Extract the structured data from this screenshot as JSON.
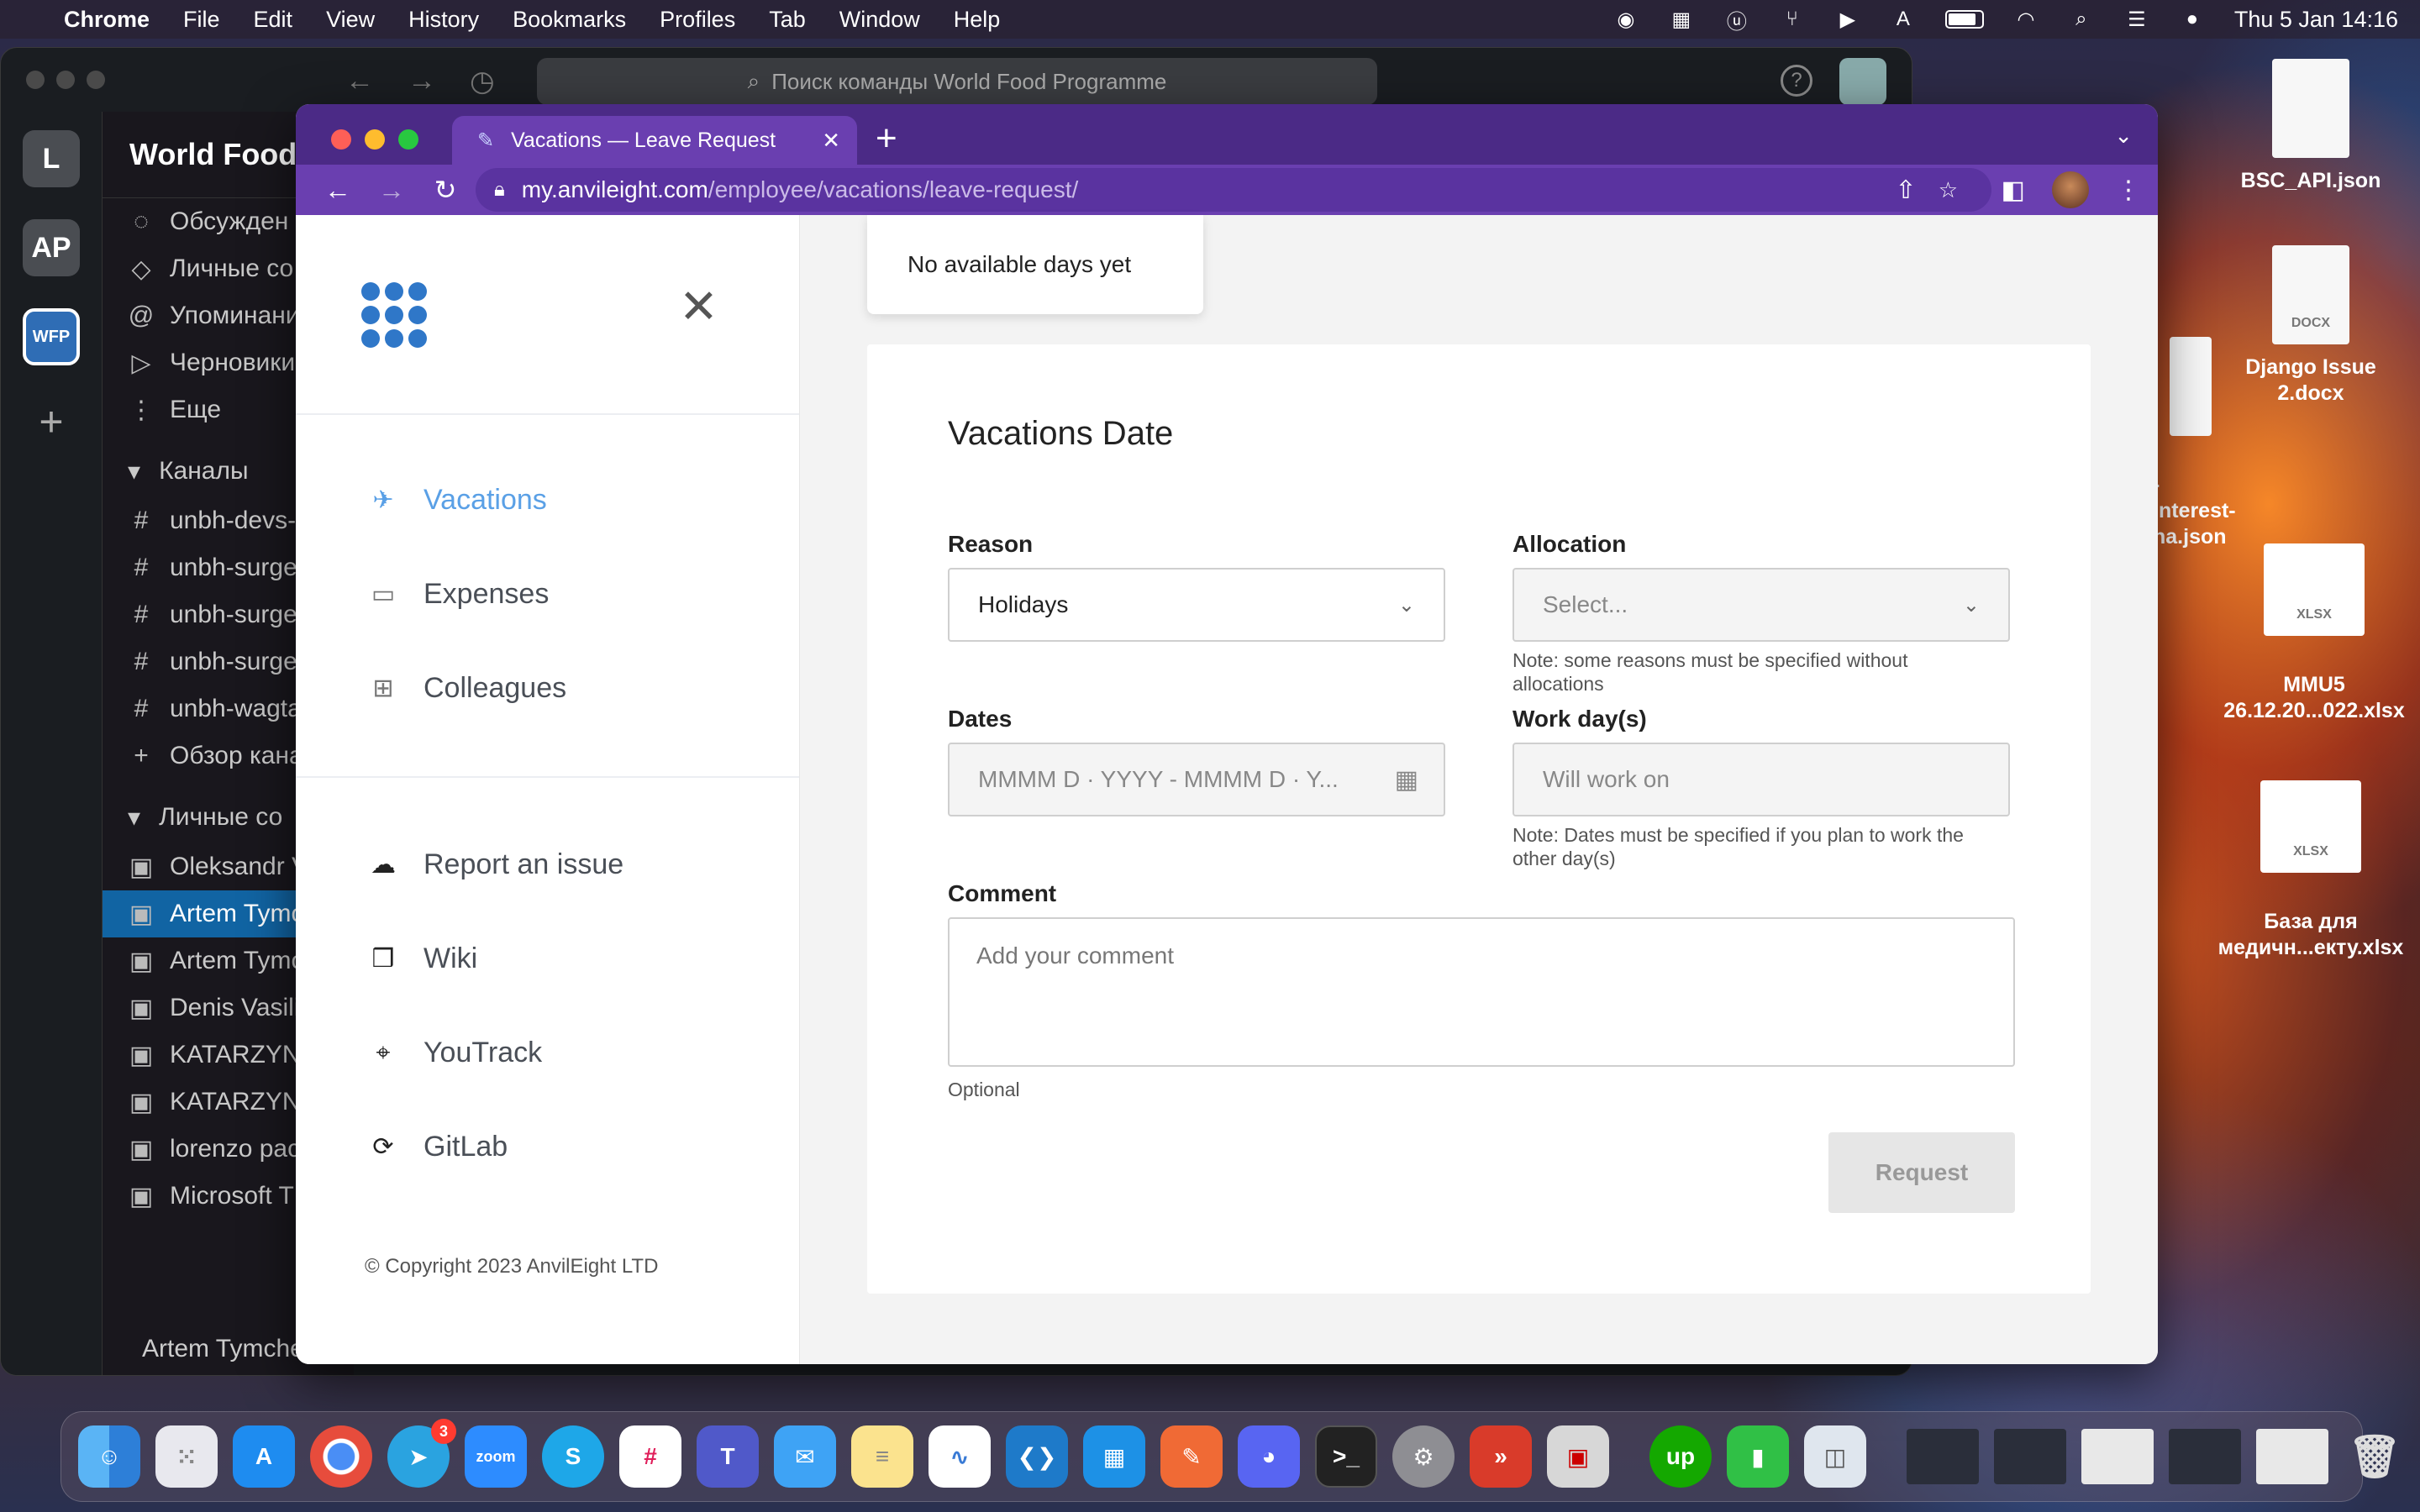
{
  "menubar": {
    "app": "Chrome",
    "items": [
      "File",
      "Edit",
      "View",
      "History",
      "Bookmarks",
      "Profiles",
      "Tab",
      "Window",
      "Help"
    ],
    "datetime": "Thu 5 Jan  14:16"
  },
  "slack": {
    "search_placeholder": "Поиск команды World Food Programme",
    "workspaces": [
      "L",
      "AP",
      "WFP"
    ],
    "workspace_name": "World Food",
    "nav": [
      "Обсужден",
      "Личные со",
      "Упоминани",
      "Черновики",
      "Еще"
    ],
    "channels_header": "Каналы",
    "channels": [
      "unbh-devs-",
      "unbh-surge",
      "unbh-surge",
      "unbh-surge",
      "unbh-wagta"
    ],
    "browse": "Обзор кана",
    "dms_header": "Личные со",
    "dms": [
      "Oleksandr V",
      "Artem Tymc",
      "Artem Tymc",
      "Denis Vasili",
      "KATARZYN",
      "KATARZYN",
      "lorenzo pac",
      "Microsoft T"
    ],
    "footer_user": "Artem Tymche"
  },
  "chrome": {
    "tab_title": "Vacations — Leave Request",
    "url_host": "my.anvileight.com",
    "url_path": "/employee/vacations/leave-request/"
  },
  "sidebar": {
    "nav": [
      {
        "label": "Vacations",
        "icon": "plane-icon"
      },
      {
        "label": "Expenses",
        "icon": "wallet-icon"
      },
      {
        "label": "Colleagues",
        "icon": "briefcase-icon"
      }
    ],
    "links": [
      {
        "label": "Report an issue",
        "icon": "cloud-icon"
      },
      {
        "label": "Wiki",
        "icon": "book-icon"
      },
      {
        "label": "YouTrack",
        "icon": "crosshair-icon"
      },
      {
        "label": "GitLab",
        "icon": "sync-icon"
      }
    ],
    "copyright": "© Copyright 2023 AnvilEight LTD"
  },
  "popover": {
    "text": "No available days yet"
  },
  "form": {
    "title": "Vacations Date",
    "reason_label": "Reason",
    "reason_value": "Holidays",
    "allocation_label": "Allocation",
    "allocation_placeholder": "Select...",
    "allocation_note": "Note: some reasons must be specified without allocations",
    "dates_label": "Dates",
    "dates_placeholder": "MMMM D · YYYY - MMMM D · Y...",
    "workdays_label": "Work day(s)",
    "workdays_placeholder": "Will work on",
    "workdays_note": "Note: Dates must be specified if you plan to work the other day(s)",
    "comment_label": "Comment",
    "comment_placeholder": "Add your comment",
    "comment_hint": "Optional",
    "submit_label": "Request"
  },
  "desktop_files": [
    {
      "name": "BSC_API.json"
    },
    {
      "name": "Django Issue 2.docx",
      "type": "DOCX"
    },
    {
      "name": "-interest-\nna.json"
    },
    {
      "name": "MMU5\n26.12.20...022.xlsx",
      "type": "XLSX"
    },
    {
      "name": "База для\nмедичн...екту.xlsx",
      "type": "XLSX"
    }
  ],
  "dock": {
    "telegram_badge": "3",
    "zoom_label": "zoom"
  },
  "colors": {
    "chrome_frame": "#4b2a86",
    "accent_blue": "#5aa0e6",
    "logo_blue": "#2f77c8"
  }
}
